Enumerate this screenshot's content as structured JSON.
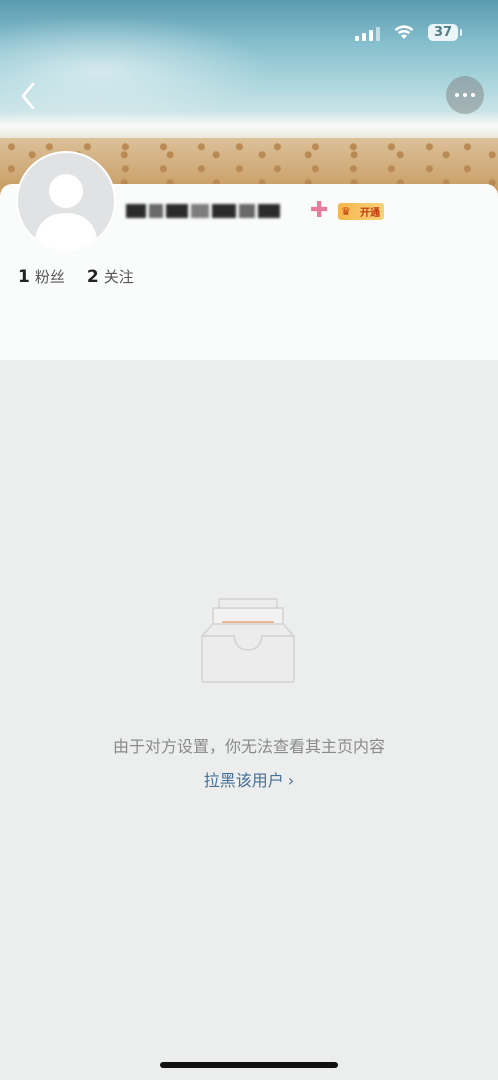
{
  "status_bar": {
    "battery_level": "37"
  },
  "icons": {
    "back": "chevron-left-icon",
    "more": "more-dots-icon",
    "signal": "signal-icon",
    "wifi": "wifi-icon",
    "battery": "battery-icon",
    "empty": "inbox-tray-icon"
  },
  "profile": {
    "vip_badge_label": "开通",
    "stats": [
      {
        "count": "1",
        "label": "粉丝"
      },
      {
        "count": "2",
        "label": "关注"
      }
    ]
  },
  "empty_state": {
    "message": "由于对方设置，你无法查看其主页内容",
    "action_label": "拉黑该用户",
    "action_chevron": "›"
  },
  "colors": {
    "link": "#486f97",
    "vip_plus": "#e87a9c",
    "vip_badge": "#f6b64c",
    "empty_line": "#f0a278"
  }
}
